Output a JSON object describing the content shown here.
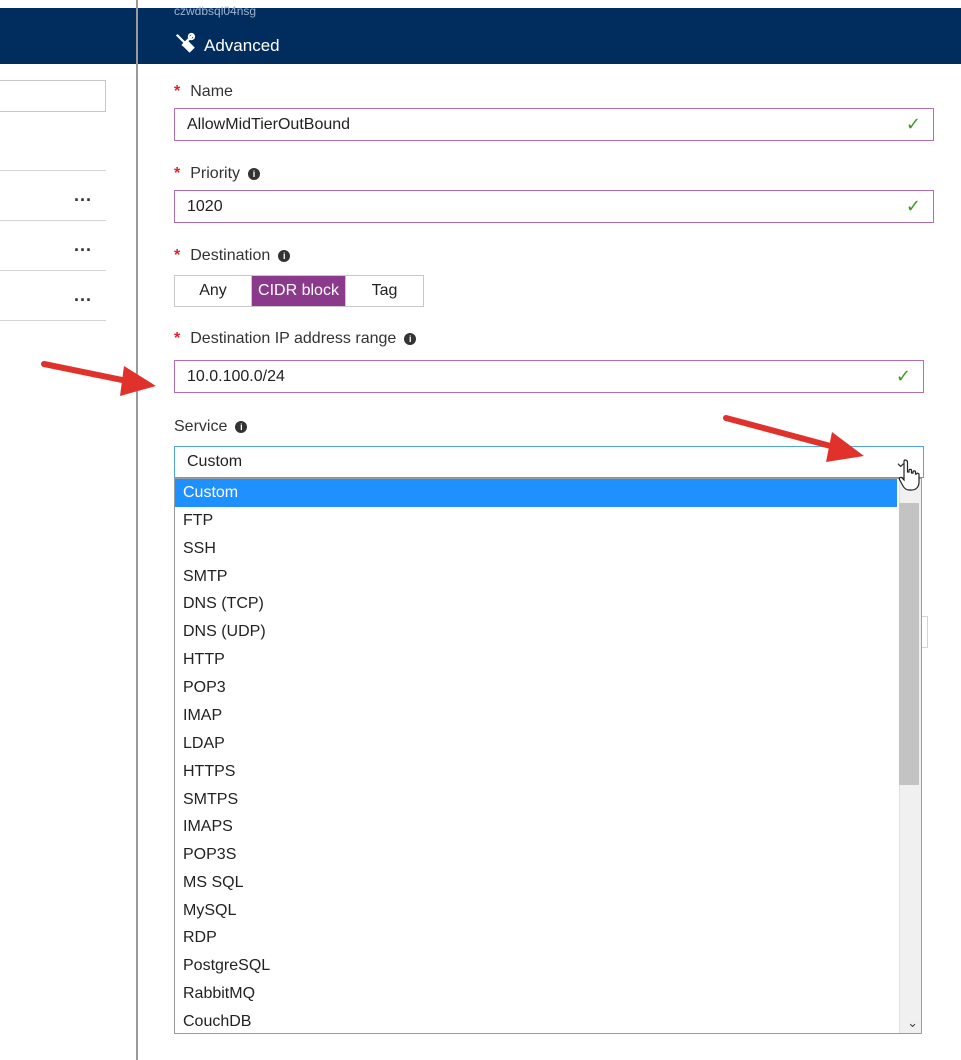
{
  "header": {
    "subtitle": "czwdbsql04nsg",
    "title": "Advanced"
  },
  "left_pane": {
    "rows": [
      {
        "more_label": "..."
      },
      {
        "more_label": "..."
      },
      {
        "more_label": "..."
      }
    ]
  },
  "form": {
    "required_marker": "*",
    "name": {
      "label": "Name",
      "value": "AllowMidTierOutBound"
    },
    "priority": {
      "label": "Priority",
      "value": "1020"
    },
    "destination": {
      "label": "Destination",
      "options": [
        "Any",
        "CIDR block",
        "Tag"
      ],
      "selected": "CIDR block"
    },
    "destination_ip": {
      "label": "Destination IP address range",
      "value": "10.0.100.0/24"
    },
    "service": {
      "label": "Service",
      "value": "Custom",
      "options": [
        "Custom",
        "FTP",
        "SSH",
        "SMTP",
        "DNS (TCP)",
        "DNS (UDP)",
        "HTTP",
        "POP3",
        "IMAP",
        "LDAP",
        "HTTPS",
        "SMTPS",
        "IMAPS",
        "POP3S",
        "MS SQL",
        "MySQL",
        "RDP",
        "PostgreSQL",
        "RabbitMQ",
        "CouchDB"
      ]
    }
  },
  "icons": {
    "info": "info-icon",
    "check": "checkmark-icon",
    "chevron": "chevron-down-icon",
    "tools": "wrench-screwdriver-icon"
  },
  "colors": {
    "header_bg": "#002d5e",
    "accent_purple": "#8b3a8b",
    "selection_blue": "#1e90ff",
    "valid_green": "#3a9a22",
    "required_red": "#e0202f",
    "annotation_arrow": "#e0322a"
  }
}
